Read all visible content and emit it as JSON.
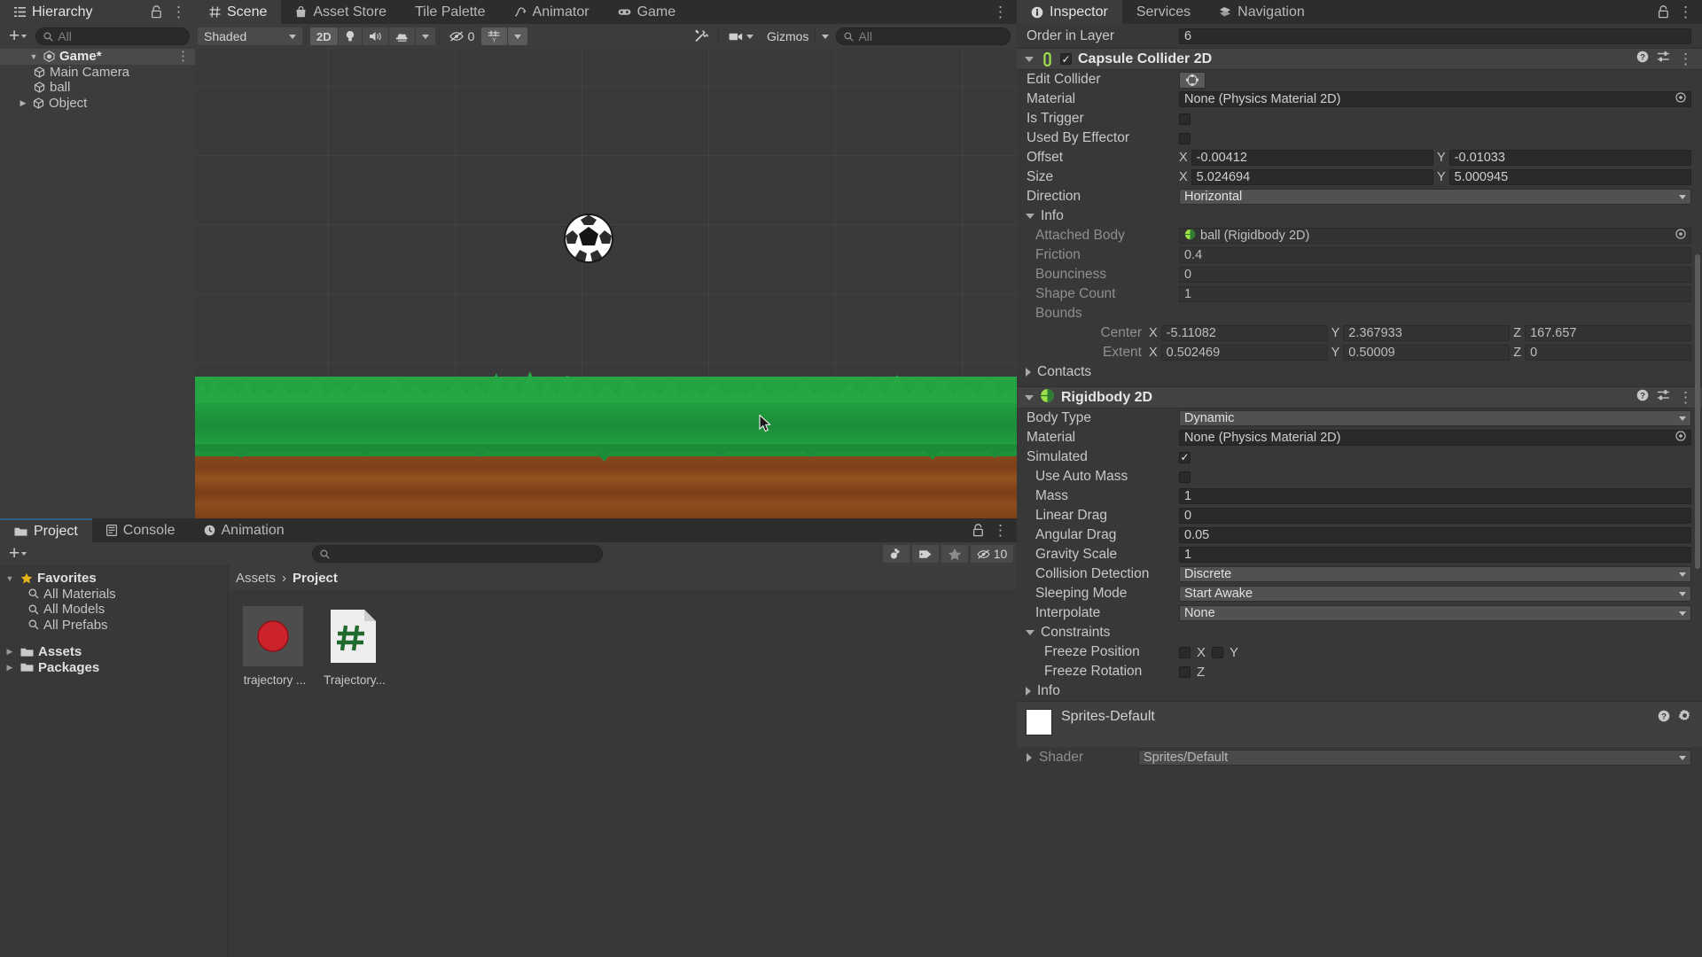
{
  "hierarchy": {
    "tab_label": "Hierarchy",
    "search_placeholder": "All",
    "rows": [
      {
        "label": "Game*",
        "kind": "scene-root",
        "expanded": true,
        "selected": true
      },
      {
        "label": "Main Camera",
        "kind": "gameobject"
      },
      {
        "label": "ball",
        "kind": "gameobject"
      },
      {
        "label": "Object",
        "kind": "gameobject",
        "collapsed": true
      }
    ]
  },
  "scene": {
    "tabs": [
      {
        "label": "Scene",
        "icon": "grid-icon",
        "active": true
      },
      {
        "label": "Asset Store",
        "icon": "store-icon",
        "active": false
      },
      {
        "label": "Tile Palette",
        "icon": "",
        "active": false
      },
      {
        "label": "Animator",
        "icon": "animator-icon",
        "active": false
      },
      {
        "label": "Game",
        "icon": "gamepad-icon",
        "active": false
      }
    ],
    "toolbar": {
      "draw_mode": "Shaded",
      "mode_2d": "2D",
      "hidden_count": "0",
      "gizmos_label": "Gizmos",
      "search_placeholder": "All"
    }
  },
  "project": {
    "tabs": [
      {
        "label": "Project",
        "icon": "folder-icon",
        "active": true
      },
      {
        "label": "Console",
        "icon": "console-icon",
        "active": false
      },
      {
        "label": "Animation",
        "icon": "clock-icon",
        "active": false
      }
    ],
    "search_placeholder": "",
    "item_count": "10",
    "tree": [
      {
        "label": "Favorites",
        "icon": "star-icon",
        "bold": true,
        "expanded": true,
        "depth": 0
      },
      {
        "label": "All Materials",
        "icon": "search-icon",
        "depth": 1
      },
      {
        "label": "All Models",
        "icon": "search-icon",
        "depth": 1
      },
      {
        "label": "All Prefabs",
        "icon": "search-icon",
        "depth": 1
      },
      {
        "label": "Assets",
        "icon": "folder-icon",
        "bold": true,
        "collapsed": true,
        "depth": 0
      },
      {
        "label": "Packages",
        "icon": "folder-icon",
        "bold": true,
        "collapsed": true,
        "depth": 0
      }
    ],
    "breadcrumb": {
      "root": "Assets",
      "sep": "›",
      "current": "Project"
    },
    "assets": [
      {
        "name": "trajectory ...",
        "icon": "red-circle-sprite"
      },
      {
        "name": "Trajectory...",
        "icon": "csharp-script"
      }
    ]
  },
  "inspector": {
    "tabs": [
      {
        "label": "Inspector",
        "icon": "info-icon",
        "active": true
      },
      {
        "label": "Services",
        "icon": "",
        "active": false
      },
      {
        "label": "Navigation",
        "icon": "navigation-icon",
        "active": false
      }
    ],
    "order_in_layer": {
      "label": "Order in Layer",
      "value": "6"
    },
    "capsule_collider": {
      "title": "Capsule Collider 2D",
      "enabled": true,
      "badge": "0",
      "rows": [
        {
          "label": "Edit Collider",
          "type": "button",
          "icon": "edit-collider-icon"
        },
        {
          "label": "Material",
          "type": "object",
          "value": "None (Physics Material 2D)"
        },
        {
          "label": "Is Trigger",
          "type": "checkbox",
          "checked": false
        },
        {
          "label": "Used By Effector",
          "type": "checkbox",
          "checked": false
        },
        {
          "label": "Offset",
          "type": "vector2",
          "x": "-0.00412",
          "y": "-0.01033"
        },
        {
          "label": "Size",
          "type": "vector2",
          "x": "5.024694",
          "y": "5.000945"
        },
        {
          "label": "Direction",
          "type": "dropdown",
          "value": "Horizontal"
        }
      ],
      "info": {
        "label": "Info",
        "expanded": true,
        "attached_body": {
          "label": "Attached Body",
          "value": "ball (Rigidbody 2D)"
        },
        "friction": {
          "label": "Friction",
          "value": "0.4"
        },
        "bounciness": {
          "label": "Bounciness",
          "value": "0"
        },
        "shape_count": {
          "label": "Shape Count",
          "value": "1"
        },
        "bounds_label": "Bounds",
        "center": {
          "label": "Center",
          "x": "-5.11082",
          "y": "2.367933",
          "z": "167.657"
        },
        "extent": {
          "label": "Extent",
          "x": "0.502469",
          "y": "0.50009",
          "z": "0"
        },
        "contacts_label": "Contacts"
      }
    },
    "rigidbody": {
      "title": "Rigidbody 2D",
      "rows": [
        {
          "label": "Body Type",
          "type": "dropdown",
          "value": "Dynamic"
        },
        {
          "label": "Material",
          "type": "object",
          "value": "None (Physics Material 2D)"
        },
        {
          "label": "Simulated",
          "type": "checkbox",
          "checked": true
        },
        {
          "label": "Use Auto Mass",
          "type": "checkbox",
          "checked": false,
          "indent": true
        },
        {
          "label": "Mass",
          "type": "text",
          "value": "1",
          "indent": true
        },
        {
          "label": "Linear Drag",
          "type": "text",
          "value": "0",
          "indent": true
        },
        {
          "label": "Angular Drag",
          "type": "text",
          "value": "0.05",
          "indent": true
        },
        {
          "label": "Gravity Scale",
          "type": "text",
          "value": "1",
          "indent": true
        },
        {
          "label": "Collision Detection",
          "type": "dropdown",
          "value": "Discrete",
          "indent": true
        },
        {
          "label": "Sleeping Mode",
          "type": "dropdown",
          "value": "Start Awake",
          "indent": true
        },
        {
          "label": "Interpolate",
          "type": "dropdown",
          "value": "None",
          "indent": true
        }
      ],
      "constraints": {
        "label": "Constraints",
        "expanded": true,
        "freeze_position": {
          "label": "Freeze Position",
          "x_label": "X",
          "y_label": "Y",
          "x": false,
          "y": false
        },
        "freeze_rotation": {
          "label": "Freeze Rotation",
          "z_label": "Z",
          "z": false
        }
      },
      "info_label": "Info"
    },
    "material": {
      "name": "Sprites-Default",
      "shader_label": "Shader",
      "shader_value": "Sprites/Default"
    }
  },
  "colors": {
    "accent_green": "#9ee04a",
    "tab_active_blue": "#2c5d87",
    "panel_bg": "#383838",
    "header_bg": "#2d2d2d",
    "field_bg": "#2a2a2a",
    "grass": "#1f9c3e",
    "dirt": "#8a4a1e",
    "asset_red": "#cc2229",
    "csharp_green": "#1f6b2e",
    "star_gold": "#e8b317"
  }
}
